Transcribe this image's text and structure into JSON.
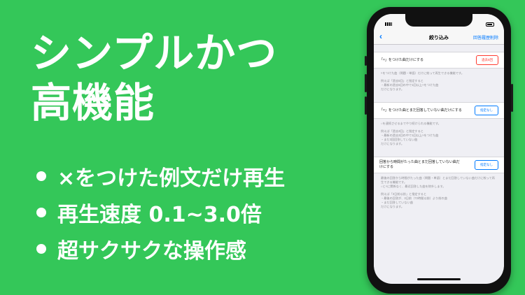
{
  "headline": {
    "line1": "シンプルかつ",
    "line2": "高機能"
  },
  "features": [
    "×をつけた例文だけ再生",
    "再生速度 0.1~3.0倍",
    "超サクサクな操作感"
  ],
  "status_bar": {
    "time": "3:26 PM"
  },
  "nav": {
    "back_icon": "chevron-left",
    "title": "絞り込み",
    "action": "回答履歴削除"
  },
  "rows": [
    {
      "label": "「×」をつけた曲だけにする",
      "button": "過去5回",
      "button_color": "#ff3b30",
      "description": [
        "×をつけた曲（問題・単語）だけに絞って再生できる機能です。",
        "例えば「過去5回」と指定すると\n・最新の過去5回の中で1回以上×をつけた曲\nだけになります。"
      ]
    },
    {
      "label": "「×」をつけた曲とまだ回答していない曲だけにする",
      "button": "指定なし",
      "button_color": "#007aff",
      "description": [
        "○を連続させるまでやり続けられる機能です。",
        "例えば「過去3回」と指定すると\n・最新の過去3回の中で1回以上×をつけた曲\n・まだ3回回答していない曲\nだけになります。"
      ]
    },
    {
      "label": "回答から時間がたった曲とまだ回答していない曲だけにする",
      "button": "指定なし",
      "button_color": "#007aff",
      "description": [
        "最後の回答から時間がたった曲（問題・単語）とまだ回答していない曲だけに絞って再生できる機能です。\n○と×に関係なく、最近回答した曲を除外します。",
        "例えば「3日前以前」と指定すると\n・最後の回答が、3日前（72時間以前）より前の曲\n・まだ回答していない曲\nだけになります。"
      ]
    }
  ],
  "colors": {
    "background": "#34c759",
    "accent_blue": "#007aff",
    "accent_red": "#ff3b30"
  }
}
